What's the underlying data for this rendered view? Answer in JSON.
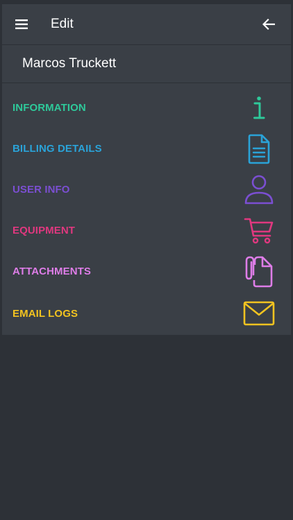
{
  "appbar": {
    "title": "Edit",
    "menu_icon": "hamburger-menu-icon",
    "back_icon": "arrow-left-icon"
  },
  "customer": {
    "name": "Marcos Truckett"
  },
  "menu": {
    "items": [
      {
        "label": "INFORMATION",
        "icon": "info-icon",
        "color": "#2ec99a"
      },
      {
        "label": "BILLING DETAILS",
        "icon": "document-icon",
        "color": "#2aa3d8"
      },
      {
        "label": "USER INFO",
        "icon": "user-icon",
        "color": "#7b4fd2"
      },
      {
        "label": "EQUIPMENT",
        "icon": "cart-icon",
        "color": "#e0387f"
      },
      {
        "label": "ATTACHMENTS",
        "icon": "attachment-icon",
        "color": "#de7de8"
      },
      {
        "label": "EMAIL LOGS",
        "icon": "envelope-icon",
        "color": "#f2c320"
      }
    ]
  },
  "colors": {
    "background": "#2d3137",
    "surface": "#3a3f46",
    "text": "#ffffff"
  }
}
